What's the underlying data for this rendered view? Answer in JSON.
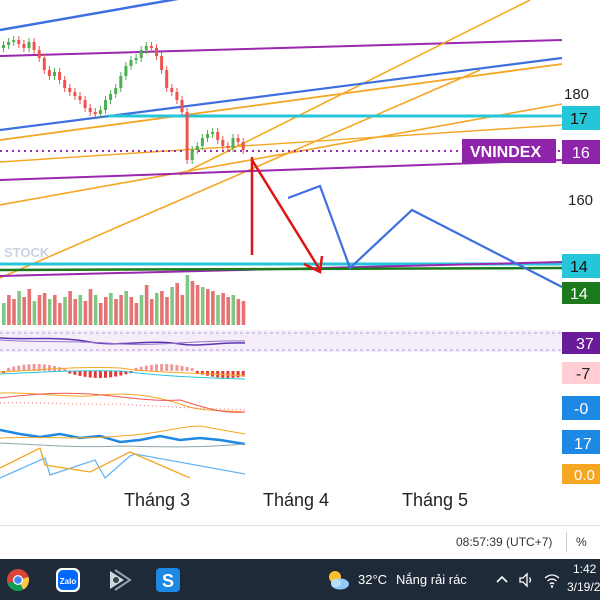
{
  "chart": {
    "symbol": "VNINDEX",
    "watermark": "STOCK",
    "months": [
      "Tháng 3",
      "Tháng 4",
      "Tháng 5"
    ],
    "price_labels": [
      "180",
      "17",
      "16",
      "160",
      "14",
      "14"
    ],
    "indicator_labels": [
      "37",
      "-7",
      "-0",
      "17",
      "0.0"
    ],
    "colors": {
      "bg": "#ffffff",
      "up": "#4caf50",
      "down": "#ef5350",
      "cyan_line": "#26c6da",
      "purple_line": "#9c27b0",
      "blue_line": "#3d6fe0",
      "orange_line": "#f5a623",
      "green_line": "#1b7a1b",
      "arrow_red": "#e01414",
      "symbol_tag": "#8e24aa"
    }
  },
  "status_bar": {
    "time": "08:57:39 (UTC+7)",
    "percent": "%"
  },
  "taskbar": {
    "apps": [
      "chrome-icon",
      "zalo-icon",
      "media-icon",
      "app-s-icon"
    ],
    "zalo_label": "Zalo",
    "s_label": "S",
    "weather_temp": "32°C",
    "weather_desc": "Nắng rải rác",
    "clock_time": "1:42",
    "clock_date": "3/19/2"
  }
}
